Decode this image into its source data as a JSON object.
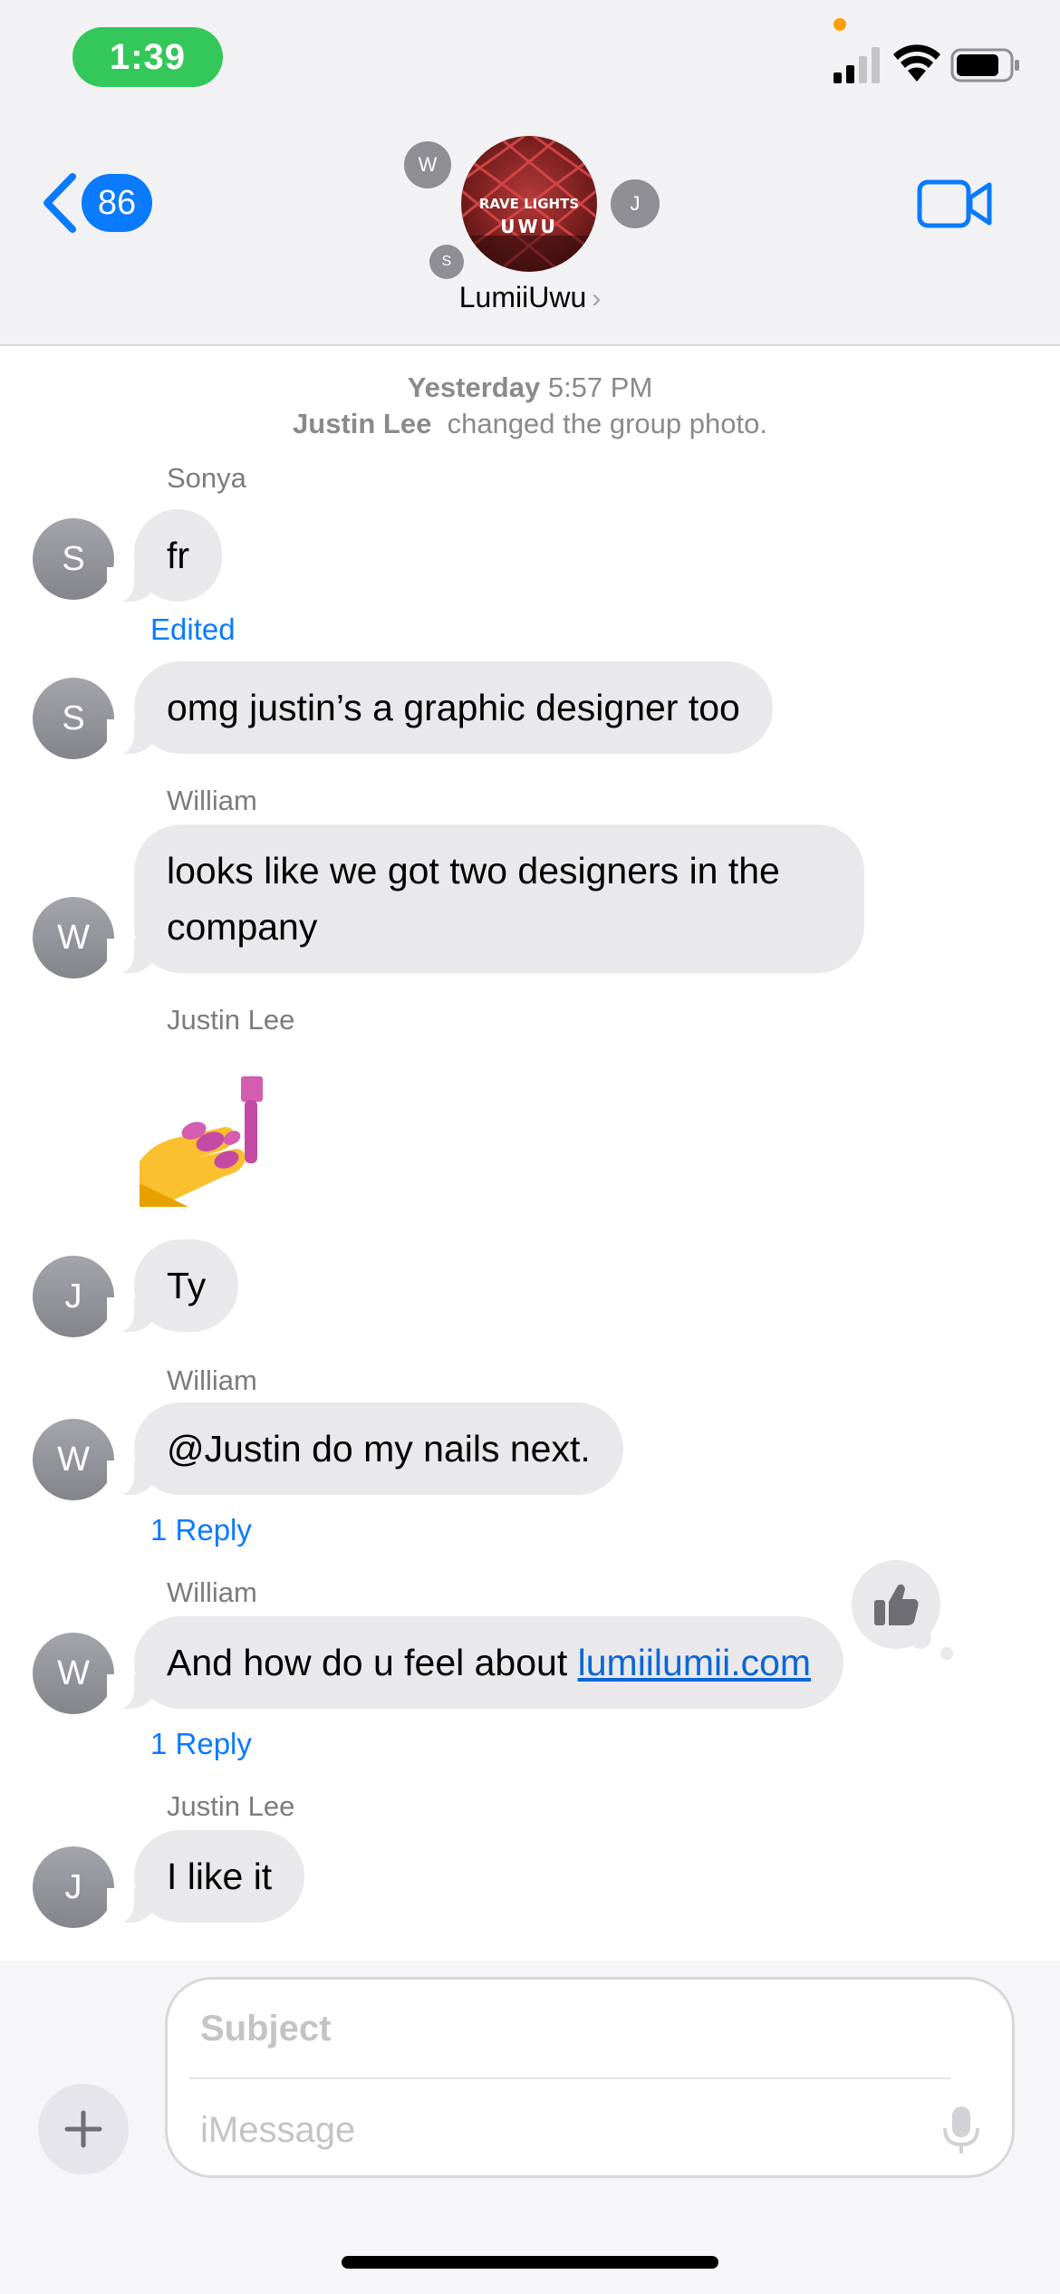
{
  "status_bar": {
    "time": "1:39",
    "icons": [
      "cellular-signal-icon",
      "wifi-icon",
      "battery-icon"
    ],
    "privacy_indicator_color": "#ff9f0a"
  },
  "header": {
    "back_count": "86",
    "group_name": "LumiiUwu",
    "group_photo_text": {
      "line1": "RAVE LIGHTS",
      "line2": "UWU"
    },
    "member_initials": [
      "W",
      "J",
      "S"
    ],
    "video_call_icon": "video-camera-icon"
  },
  "conversation": {
    "timestamp_day": "Yesterday",
    "timestamp_time": "5:57 PM",
    "system_note": {
      "actor": "Justin Lee",
      "text": "changed the group photo."
    },
    "messages": [
      {
        "sender": "Sonya",
        "avatar": "S",
        "text": "fr",
        "meta": "Edited"
      },
      {
        "sender": "",
        "avatar": "S",
        "text": "omg justin’s a graphic designer too"
      },
      {
        "sender": "William",
        "avatar": "W",
        "line1": "looks like we got two designers in the",
        "line2": "company"
      },
      {
        "sender": "Justin Lee",
        "sticker": "nail-polish-emoji"
      },
      {
        "sender": "",
        "avatar": "J",
        "text": "Ty"
      },
      {
        "sender": "William",
        "avatar": "W",
        "text": "@Justin do my nails next.",
        "meta": "1 Reply"
      },
      {
        "sender": "William",
        "avatar": "W",
        "text_prefix": "And how do u feel about ",
        "link": "lumiilumii.com",
        "meta": "1 Reply",
        "tapback": "thumbs-up-icon"
      },
      {
        "sender": "Justin Lee",
        "avatar": "J",
        "text": "I like it"
      }
    ]
  },
  "composer": {
    "subject_placeholder": "Subject",
    "message_placeholder": "iMessage",
    "plus_icon": "plus-icon",
    "mic_icon": "microphone-icon"
  },
  "colors": {
    "accent": "#0a7aff",
    "time_pill": "#34c759",
    "bubble_gray": "#e9e9eb",
    "header_bg": "#f2f2f4"
  }
}
